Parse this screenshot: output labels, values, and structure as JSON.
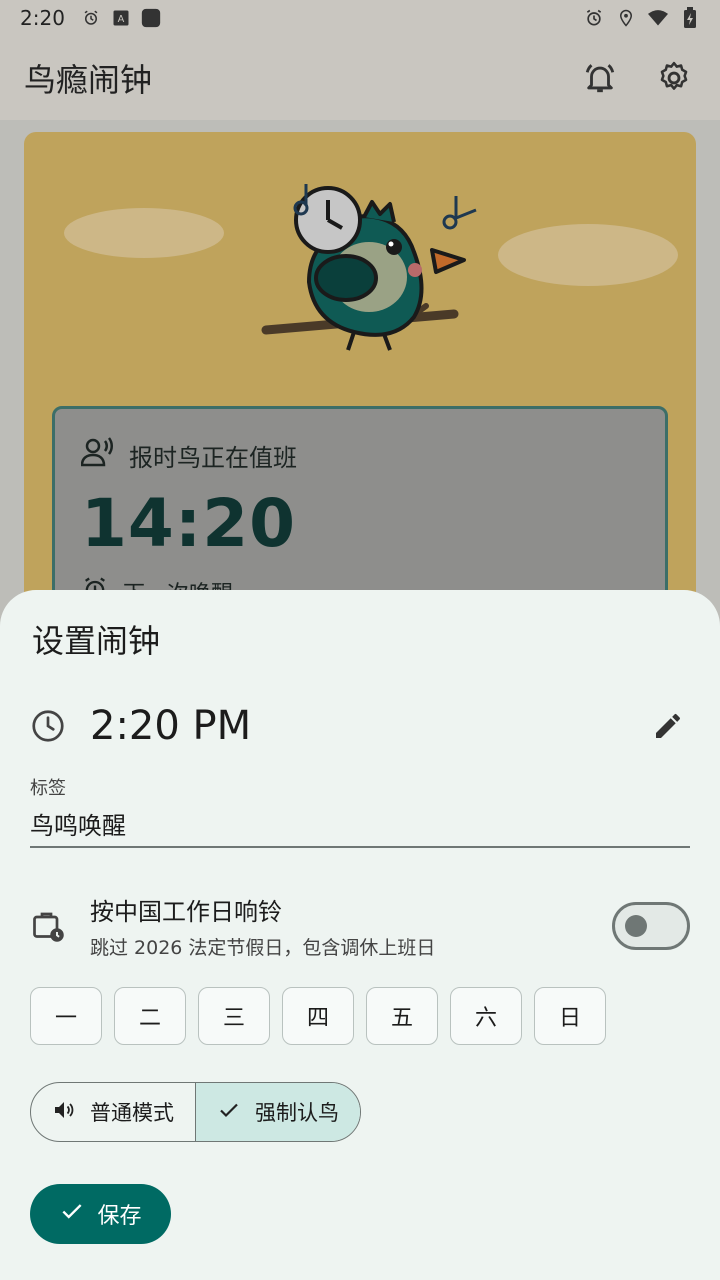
{
  "status_bar": {
    "time": "2:20",
    "left_icons": [
      "alarm-icon",
      "font-icon",
      "app-icon"
    ],
    "right_icons": [
      "alarm-icon",
      "location-icon",
      "wifi-icon",
      "battery-charging-icon"
    ]
  },
  "app_bar": {
    "title": "鸟瘾闹钟",
    "actions": [
      "bell-icon",
      "settings-icon"
    ]
  },
  "background_card": {
    "status_text": "报时鸟正在值班",
    "big_time": "14:20",
    "next_label": "下一次唤醒"
  },
  "sheet": {
    "title": "设置闹钟",
    "time_value": "2:20 PM",
    "label_caption": "标签",
    "label_value": "鸟鸣唤醒",
    "holiday_title": "按中国工作日响铃",
    "holiday_subtitle": "跳过 2026 法定节假日，包含调休上班日",
    "holiday_enabled": false,
    "weekdays": [
      "一",
      "二",
      "三",
      "四",
      "五",
      "六",
      "日"
    ],
    "mode_options": [
      {
        "label": "普通模式",
        "icon": "volume-icon",
        "selected": false
      },
      {
        "label": "强制认鸟",
        "icon": "check-icon",
        "selected": true
      }
    ],
    "save_label": "保存"
  },
  "colors": {
    "primary": "#006a63",
    "selected_segment": "#cde8e3",
    "sheet_background": "#eef4f1"
  }
}
